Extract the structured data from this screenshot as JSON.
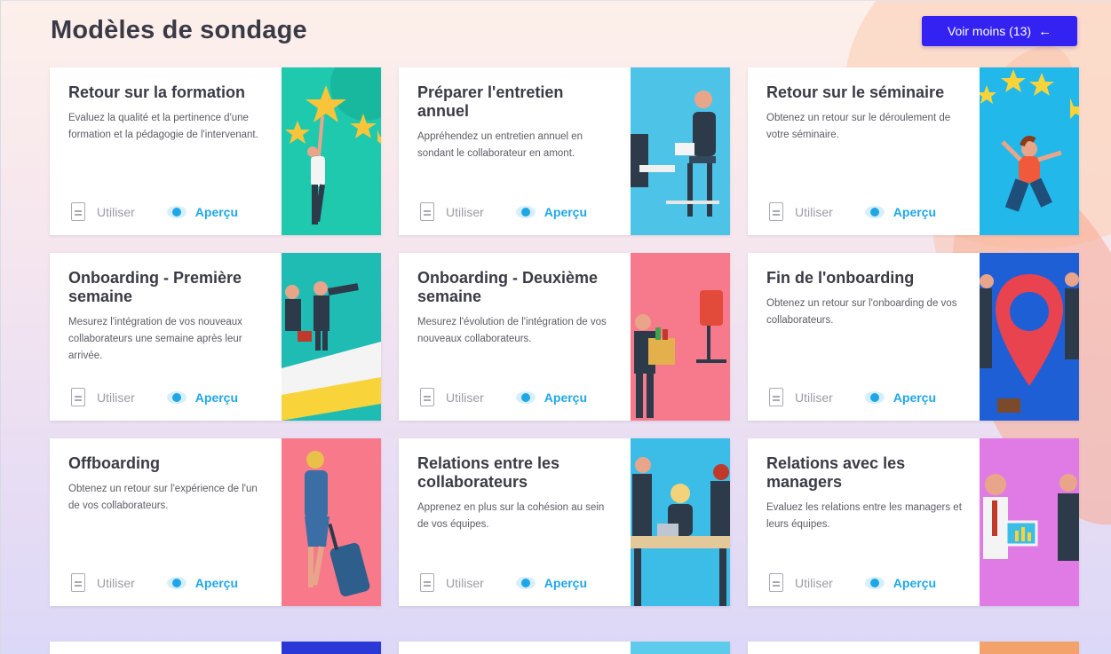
{
  "page_title": "Modèles de sondage",
  "toggle_button": {
    "label": "Voir moins (13)",
    "arrow": "←"
  },
  "actions": {
    "use_label": "Utiliser",
    "preview_label": "Aperçu"
  },
  "colors": {
    "accent": "#3322f2",
    "preview": "#1fa6e6",
    "title": "#3a3a46"
  },
  "cards": [
    {
      "title": "Retour sur la formation",
      "description": "Evaluez la qualité et la pertinence d'une formation et la pédagogie de l'intervenant.",
      "illustration": "stars-person-illustration",
      "bg": "#1ec9ae"
    },
    {
      "title": "Préparer l'entretien annuel",
      "description": "Appréhendez un entretien annuel en sondant le collaborateur en amont.",
      "illustration": "interview-chairs-illustration",
      "bg": "#4ec3e8"
    },
    {
      "title": "Retour sur le séminaire",
      "description": "Obtenez un retour sur le déroulement de votre séminaire.",
      "illustration": "jumping-person-illustration",
      "bg": "#22b8ea"
    },
    {
      "title": "Onboarding - Première semaine",
      "description": "Mesurez l'intégration de vos nouveaux collaborateurs une semaine après leur arrivée.",
      "illustration": "telescope-illustration",
      "bg": "#1fbcb4"
    },
    {
      "title": "Onboarding - Deuxième semaine",
      "description": "Mesurez l'évolution de l'intégration de vos nouveaux collaborateurs.",
      "illustration": "moving-box-illustration",
      "bg": "#f77a8c"
    },
    {
      "title": "Fin de l'onboarding",
      "description": "Obtenez un retour sur l'onboarding de vos collaborateurs.",
      "illustration": "map-pin-illustration",
      "bg": "#1e5fd6"
    },
    {
      "title": "Offboarding",
      "description": "Obtenez un retour sur l'expérience de l'un de vos collaborateurs.",
      "illustration": "suitcase-traveler-illustration",
      "bg": "#f7798a"
    },
    {
      "title": "Relations entre les collaborateurs",
      "description": "Apprenez en plus sur la cohésion au sein de vos équipes.",
      "illustration": "team-table-illustration",
      "bg": "#3bbde8"
    },
    {
      "title": "Relations avec les managers",
      "description": "Evaluez les relations entre les managers et leurs équipes.",
      "illustration": "presentation-illustration",
      "bg": "#e07be6"
    }
  ]
}
